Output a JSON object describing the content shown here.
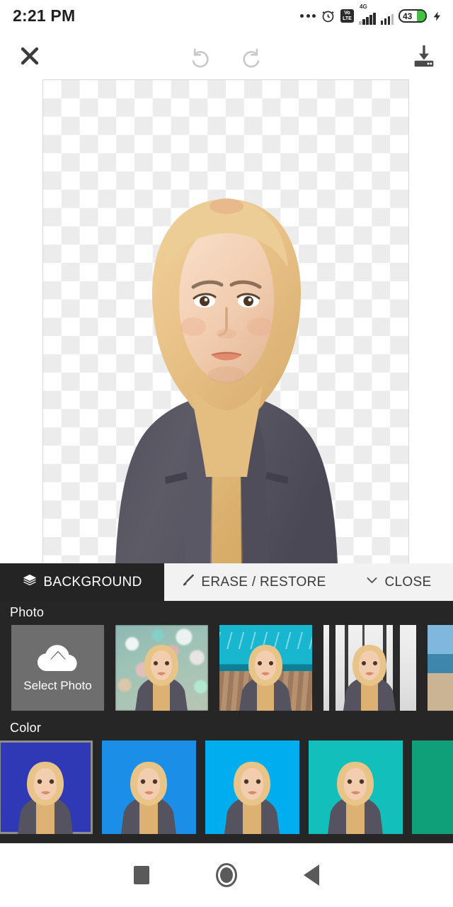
{
  "statusbar": {
    "time": "2:21 PM",
    "volte_top": "Vo",
    "volte_bottom": "LTE",
    "network_label": "4G",
    "battery_percent": "43",
    "icons": [
      "more-dots-icon",
      "alarm-clock-icon",
      "volte-icon",
      "signal-4g-icon",
      "signal-second-icon",
      "battery-icon",
      "charging-bolt-icon"
    ]
  },
  "toolbar": {
    "close_label": "close-icon",
    "undo_label": "undo-icon",
    "redo_label": "redo-icon",
    "save_label": "save-icon"
  },
  "canvas": {
    "background_state": "transparent",
    "checker_light": "#ffffff",
    "checker_dark": "#ececec",
    "subject": "woman-in-hijab-and-blazer-portrait"
  },
  "tabs": [
    {
      "label": "BACKGROUND",
      "icon": "layers-icon",
      "active": true
    },
    {
      "label": "ERASE / RESTORE",
      "icon": "brush-icon",
      "active": false
    },
    {
      "label": "CLOSE",
      "icon": "chevron-down-icon",
      "active": false
    }
  ],
  "panel": {
    "photo_section": {
      "label": "Photo",
      "select_photo_label": "Select Photo",
      "select_photo_icon": "cloud-upload-icon",
      "thumbnails": [
        {
          "name": "bokeh-lights",
          "scene": "bokeh"
        },
        {
          "name": "wooden-pier-turquoise-sky",
          "scene": "pier"
        },
        {
          "name": "snowy-winter-trees",
          "scene": "winter"
        },
        {
          "name": "beach-shoreline",
          "scene": "beach"
        }
      ]
    },
    "color_section": {
      "label": "Color",
      "swatches": [
        {
          "name": "indigo-blue",
          "hex": "#3039B5",
          "selected": true
        },
        {
          "name": "azure-blue",
          "hex": "#1B8FE8",
          "selected": false
        },
        {
          "name": "cyan-blue",
          "hex": "#00AEEF",
          "selected": false
        },
        {
          "name": "teal",
          "hex": "#13BFBA",
          "selected": false
        },
        {
          "name": "green-teal",
          "hex": "#0FA07A",
          "selected": false
        }
      ]
    }
  },
  "navbar": {
    "recents_label": "recents-button",
    "home_label": "home-button",
    "back_label": "back-button"
  }
}
